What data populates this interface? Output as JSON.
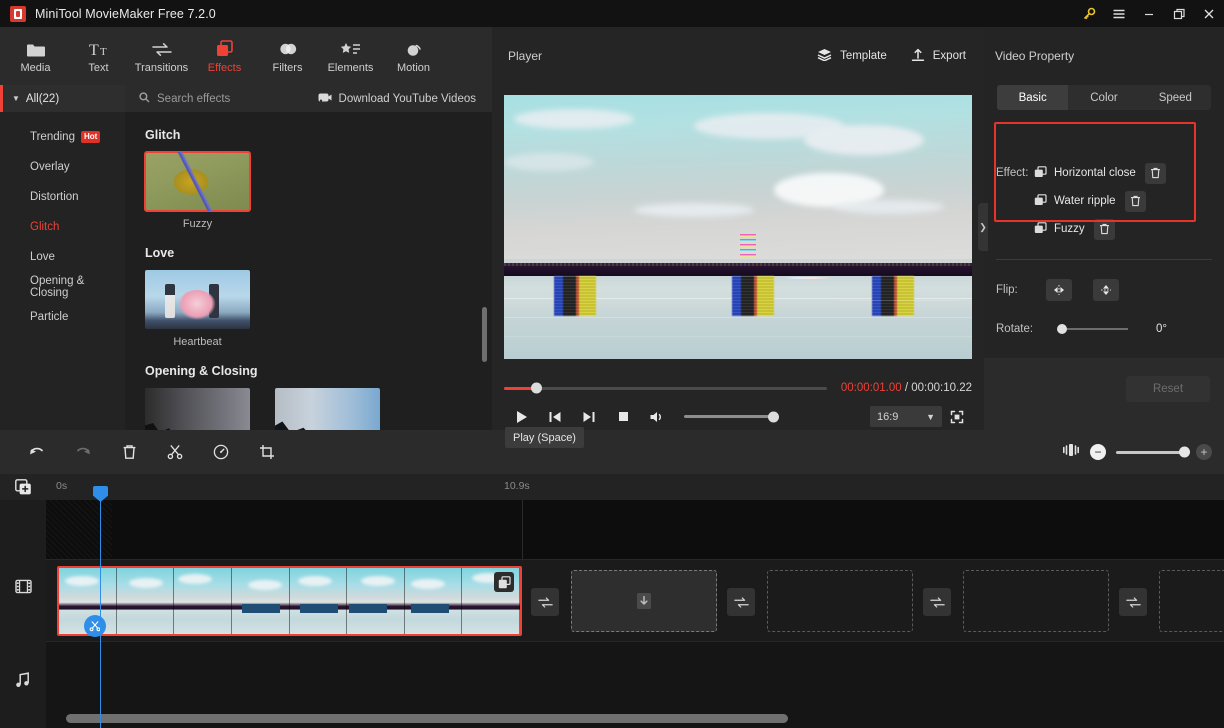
{
  "window": {
    "title": "MiniTool MovieMaker Free 7.2.0",
    "controls": {
      "key": "key-icon",
      "menu": "menu-icon",
      "minimize": "minimize-icon",
      "restore": "restore-icon",
      "close": "close-icon"
    }
  },
  "ribbon": {
    "items": [
      {
        "label": "Media",
        "icon": "folder-icon",
        "active": false
      },
      {
        "label": "Text",
        "icon": "text-icon",
        "active": false
      },
      {
        "label": "Transitions",
        "icon": "transitions-icon",
        "active": false
      },
      {
        "label": "Effects",
        "icon": "effects-icon",
        "active": true
      },
      {
        "label": "Filters",
        "icon": "filters-icon",
        "active": false
      },
      {
        "label": "Elements",
        "icon": "elements-icon",
        "active": false
      },
      {
        "label": "Motion",
        "icon": "motion-icon",
        "active": false
      }
    ]
  },
  "categories": {
    "all_label": "All(22)",
    "items": [
      {
        "label": "Trending",
        "badge": "Hot",
        "selected": false
      },
      {
        "label": "Overlay",
        "badge": "",
        "selected": false
      },
      {
        "label": "Distortion",
        "badge": "",
        "selected": false
      },
      {
        "label": "Glitch",
        "badge": "",
        "selected": true
      },
      {
        "label": "Love",
        "badge": "",
        "selected": false
      },
      {
        "label": "Opening & Closing",
        "badge": "",
        "selected": false
      },
      {
        "label": "Particle",
        "badge": "",
        "selected": false
      }
    ]
  },
  "browser": {
    "search_placeholder": "Search effects",
    "download_label": "Download YouTube Videos",
    "groups": [
      {
        "title": "Glitch",
        "items": [
          {
            "name": "Fuzzy",
            "selected": true,
            "art": "art-bird"
          }
        ]
      },
      {
        "title": "Love",
        "items": [
          {
            "name": "Heartbeat",
            "selected": false,
            "art": "art-heart"
          }
        ]
      },
      {
        "title": "Opening & Closing",
        "items": [
          {
            "name": "",
            "selected": false,
            "art": "art-dark"
          },
          {
            "name": "",
            "selected": false,
            "art": "art-blue"
          }
        ]
      }
    ]
  },
  "player": {
    "title": "Player",
    "template_label": "Template",
    "export_label": "Export",
    "current_time": "00:00:01.00",
    "separator": " / ",
    "total_time": "00:00:10.22",
    "progress_percent": 10,
    "aspect_ratio": "16:9",
    "volume_percent": 100,
    "tooltip": "Play (Space)",
    "buttons": {
      "play": "play-icon",
      "prev_frame": "previous-frame-icon",
      "next_frame": "next-frame-icon",
      "stop": "stop-icon",
      "volume": "volume-icon",
      "fullscreen": "fullscreen-icon"
    }
  },
  "property": {
    "title": "Video Property",
    "tabs": [
      {
        "label": "Basic",
        "active": true
      },
      {
        "label": "Color",
        "active": false
      },
      {
        "label": "Speed",
        "active": false
      }
    ],
    "effect_label": "Effect:",
    "effects": [
      "Horizontal close",
      "Water ripple",
      "Fuzzy"
    ],
    "flip_label": "Flip:",
    "rotate_label": "Rotate:",
    "rotate_value": "0°",
    "reset_label": "Reset",
    "highlight_color": "#e8332a"
  },
  "editbar": {
    "buttons": [
      {
        "name": "undo-button",
        "icon": "undo-icon",
        "enabled": true
      },
      {
        "name": "redo-button",
        "icon": "redo-icon",
        "enabled": false
      },
      {
        "name": "delete-button",
        "icon": "trash-icon",
        "enabled": true
      },
      {
        "name": "split-button",
        "icon": "scissors-icon",
        "enabled": true
      },
      {
        "name": "speed-button",
        "icon": "speed-icon",
        "enabled": true
      },
      {
        "name": "crop-button",
        "icon": "crop-icon",
        "enabled": true
      }
    ],
    "zoom_percent": 100
  },
  "timeline": {
    "start_label": "0s",
    "end_label": "10.9s",
    "tracks": [
      {
        "name": "text-track",
        "icon": ""
      },
      {
        "name": "video-track",
        "icon": "film-icon"
      },
      {
        "name": "audio-track",
        "icon": "music-icon"
      }
    ],
    "clip": {
      "selected": true,
      "duplicate_icon": "duplicate-icon",
      "split_icon": "scissors-icon"
    },
    "transition_slots": 4,
    "media_slots": 4
  }
}
